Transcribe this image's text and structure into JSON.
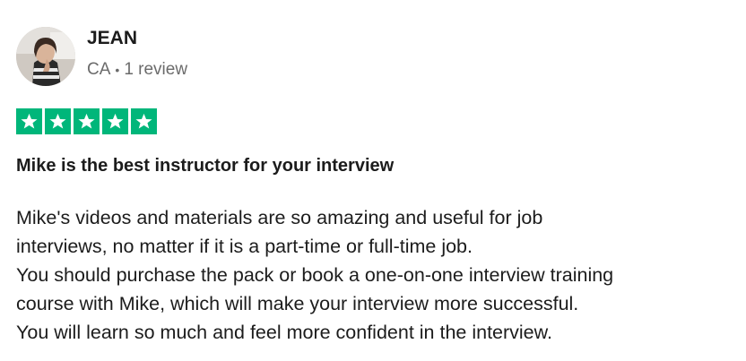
{
  "reviewer": {
    "name": "JEAN",
    "country": "CA",
    "separator": "•",
    "review_count": "1 review",
    "avatar_icon": "user-photo-icon"
  },
  "rating": {
    "stars": 5,
    "max_stars": 5,
    "star_color": "#00b67a",
    "star_icon": "star-icon"
  },
  "review": {
    "title": "Mike is the best instructor for your interview",
    "lines": [
      "Mike's videos and materials are so amazing and useful for job",
      "interviews, no matter if it is a part-time or full-time job.",
      "You should purchase the pack or book a one-on-one interview training",
      "course with Mike, which will make your interview more successful.",
      "You will learn so much and feel more confident in the interview."
    ]
  }
}
